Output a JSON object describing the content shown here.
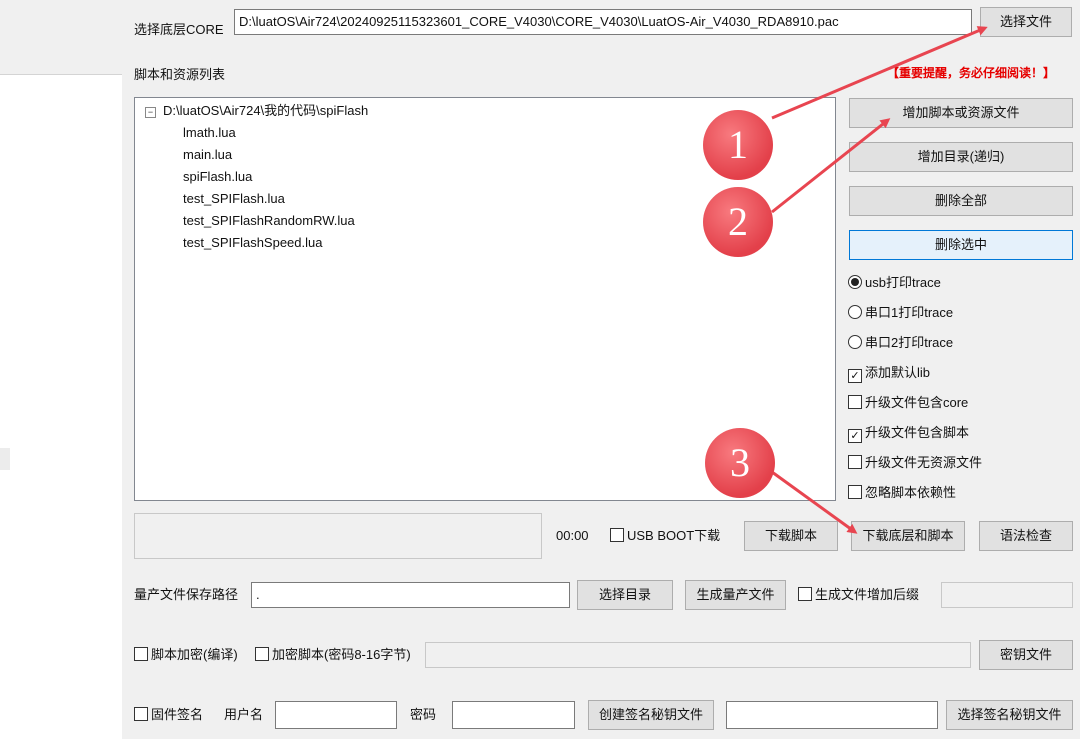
{
  "core": {
    "label": "选择底层CORE",
    "path": "D:\\luatOS\\Air724\\20240925115323601_CORE_V4030\\CORE_V4030\\LuatOS-Air_V4030_RDA8910.pac",
    "select_btn": "选择文件"
  },
  "scripts": {
    "label": "脚本和资源列表",
    "warning": "【重要提醒，务必仔细阅读！】",
    "tree_root": "D:\\luatOS\\Air724\\我的代码\\spiFlash",
    "collapse_glyph": "⊟",
    "files": [
      "lmath.lua",
      "main.lua",
      "spiFlash.lua",
      "test_SPIFlash.lua",
      "test_SPIFlashRandomRW.lua",
      "test_SPIFlashSpeed.lua"
    ]
  },
  "side_buttons": {
    "add_script": "增加脚本或资源文件",
    "add_dir": "增加目录(递归)",
    "delete_all": "删除全部",
    "delete_selected": "删除选中"
  },
  "trace_options": [
    {
      "label": "usb打印trace",
      "selected": true
    },
    {
      "label": "串口1打印trace",
      "selected": false
    },
    {
      "label": "串口2打印trace",
      "selected": false
    }
  ],
  "checkboxes": [
    {
      "label": "添加默认lib",
      "checked": true
    },
    {
      "label": "升级文件包含core",
      "checked": false
    },
    {
      "label": "升级文件包含脚本",
      "checked": true
    },
    {
      "label": "升级文件无资源文件",
      "checked": false
    },
    {
      "label": "忽略脚本依赖性",
      "checked": false
    }
  ],
  "download": {
    "time": "00:00",
    "usb_boot": "USB BOOT下载",
    "download_script": "下载脚本",
    "download_core_script": "下载底层和脚本",
    "syntax_check": "语法检查"
  },
  "production": {
    "label": "量产文件保存路径",
    "path": ".",
    "select_dir": "选择目录",
    "generate": "生成量产文件",
    "suffix_label": "生成文件增加后缀"
  },
  "encrypt": {
    "compile_label": "脚本加密(编译)",
    "encrypt_label": "加密脚本(密码8-16字节)",
    "key_file": "密钥文件"
  },
  "sign": {
    "firmware_sign": "固件签名",
    "username_label": "用户名",
    "password_label": "密码",
    "create_key": "创建签名秘钥文件",
    "select_key": "选择签名秘钥文件"
  },
  "annotations": [
    "1",
    "2",
    "3"
  ],
  "colors": {
    "annotation": "#e3404a",
    "warning": "#e60000",
    "window_bg": "#f0f0f0"
  }
}
